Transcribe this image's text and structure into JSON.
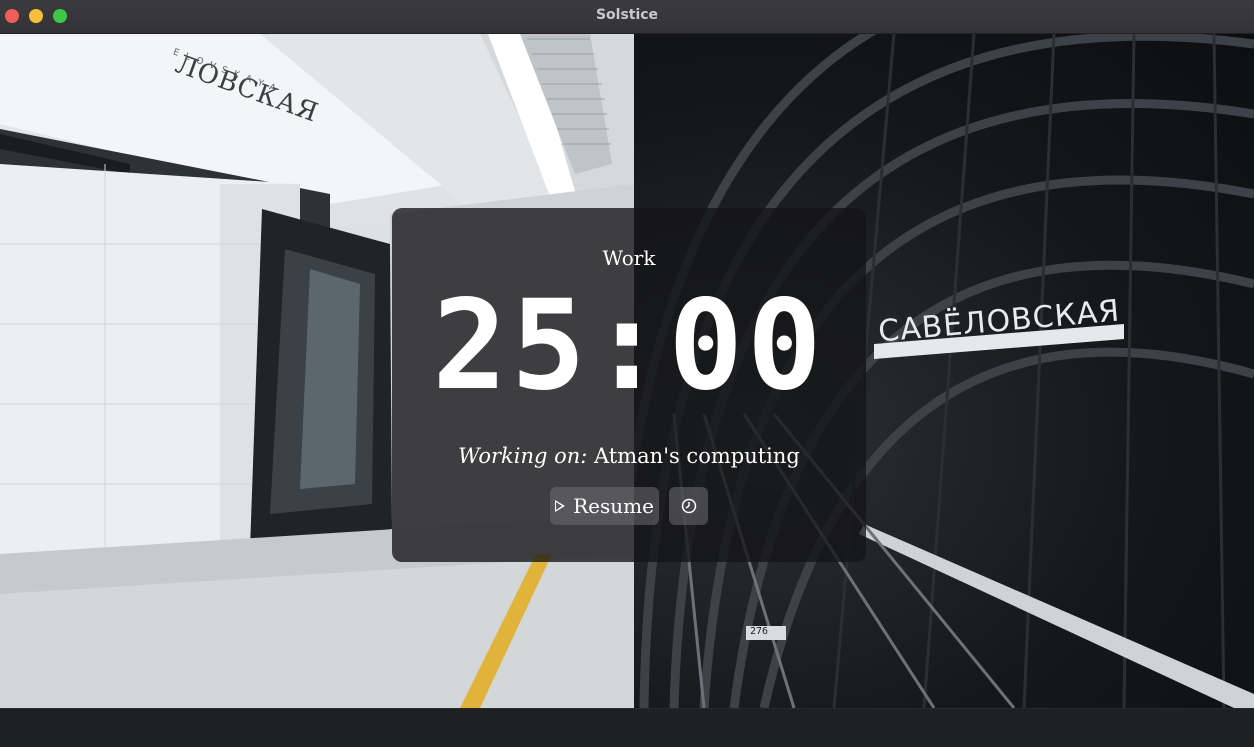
{
  "window": {
    "title": "Solstice"
  },
  "timer": {
    "mode_label": "Work",
    "time": "25:00",
    "working_on_prefix": "Working on:",
    "working_on_task": "Atman's computing"
  },
  "controls": {
    "resume_label": "Resume",
    "resume_icon": "play-icon",
    "history_icon": "clock-icon"
  },
  "background": {
    "sign_left": "ЛОВСКАЯ",
    "sign_left_sub": "E L O V S K A Y A",
    "sign_right": "САВЁЛОВСКАЯ",
    "track_number": "276",
    "colors": {
      "left_wall": "#dfe2e4",
      "tunnel": "#15181b",
      "platform_line": "#e0b43a"
    }
  }
}
